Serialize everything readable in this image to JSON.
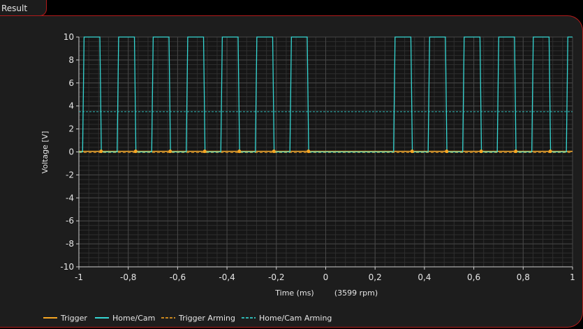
{
  "tab": {
    "label": "Result"
  },
  "chart_data": {
    "type": "line",
    "xlabel": "Time (ms)",
    "xnote": "(3599 rpm)",
    "ylabel": "Voltage [V]",
    "xlim": [
      -1,
      1
    ],
    "ylim": [
      -10,
      10
    ],
    "x_ticks": [
      -1,
      -0.8,
      -0.6,
      -0.4,
      -0.2,
      0,
      0.2,
      0.4,
      0.6,
      0.8,
      1
    ],
    "x_tick_labels": [
      "-1",
      "-0,8",
      "-0,6",
      "-0,4",
      "-0,2",
      "0",
      "0,2",
      "0,4",
      "0,6",
      "0,8",
      "1"
    ],
    "y_ticks": [
      10,
      8,
      6,
      4,
      2,
      0,
      -2,
      -4,
      -6,
      -8,
      -10
    ],
    "y_tick_labels": [
      "10",
      "8",
      "6",
      "4",
      "2",
      "0",
      "-2",
      "-4",
      "-6",
      "-8",
      "-10"
    ],
    "grid": true,
    "legend_position": "bottom",
    "series": [
      {
        "name": "Trigger",
        "style": "solid",
        "color": "#f5a623",
        "constant": 0.05,
        "markers_x": [
          -0.91,
          -0.77,
          -0.63,
          -0.49,
          -0.35,
          -0.21,
          -0.07,
          0.35,
          0.49,
          0.63,
          0.77,
          0.91
        ]
      },
      {
        "name": "Home/Cam",
        "style": "solid",
        "color": "#35d6d2",
        "low": 0,
        "high": 10,
        "pulses": [
          [
            -0.985,
            -0.915
          ],
          [
            -0.845,
            -0.775
          ],
          [
            -0.705,
            -0.635
          ],
          [
            -0.565,
            -0.495
          ],
          [
            -0.425,
            -0.355
          ],
          [
            -0.285,
            -0.215
          ],
          [
            -0.145,
            -0.075
          ],
          [
            0.275,
            0.345
          ],
          [
            0.415,
            0.485
          ],
          [
            0.555,
            0.625
          ],
          [
            0.695,
            0.765
          ],
          [
            0.835,
            0.905
          ],
          [
            0.975,
            1.0
          ]
        ]
      },
      {
        "name": "Trigger Arming",
        "style": "dashed",
        "color": "#c8861e",
        "constant": 0.0
      },
      {
        "name": "Home/Cam Arming",
        "style": "dashed",
        "color": "#2fb7b3",
        "constant": 3.5
      }
    ]
  }
}
